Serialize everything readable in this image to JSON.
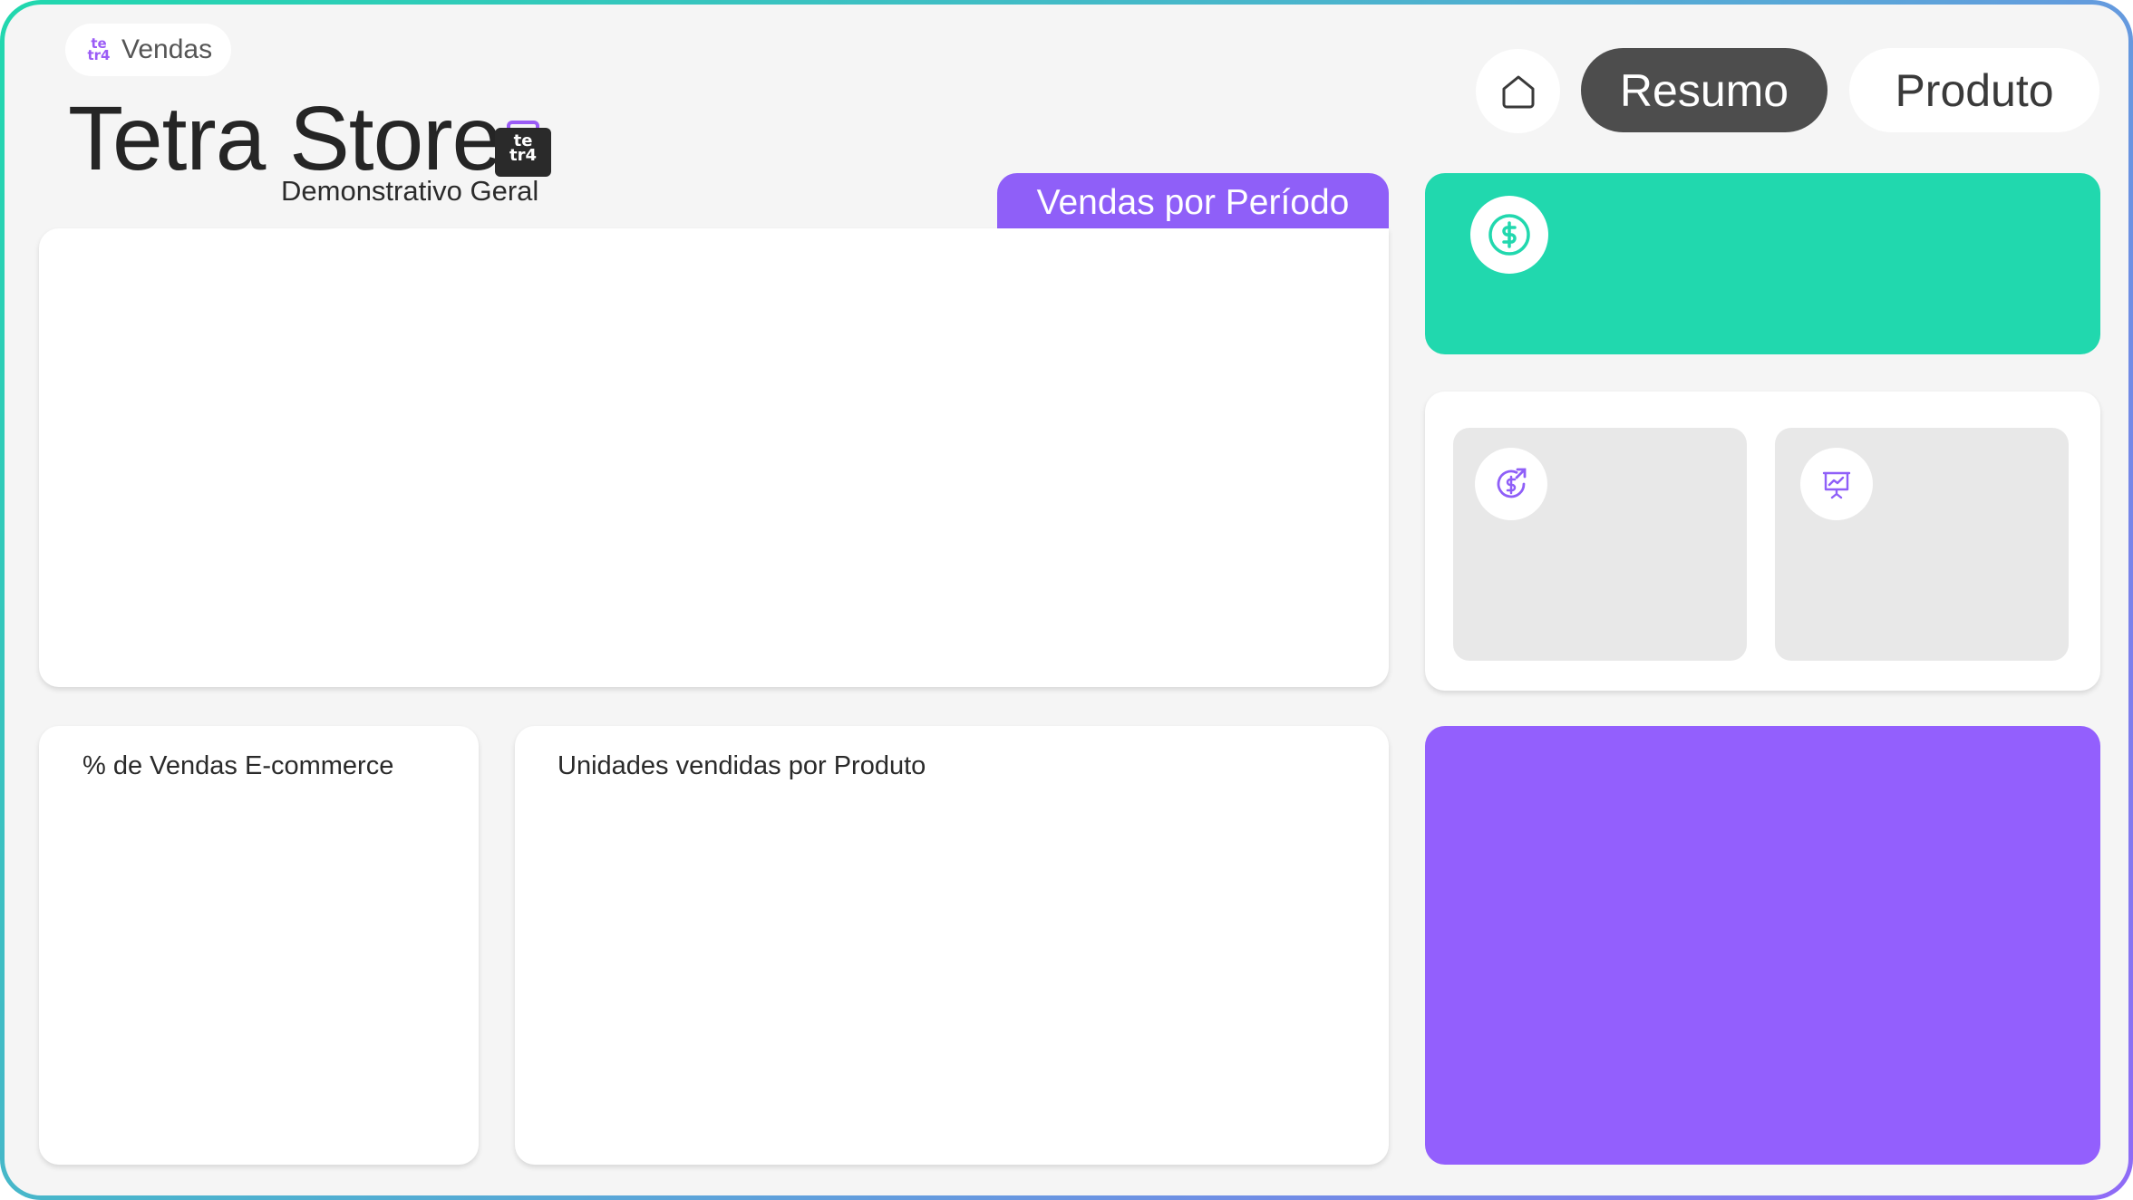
{
  "header": {
    "brand_logo_top": "te",
    "brand_logo_bottom": "tr4",
    "brand_label": "Vendas",
    "title": "Tetra Store",
    "subtitle": "Demonstrativo Geral",
    "bag_logo_top": "te",
    "bag_logo_bottom": "tr4"
  },
  "nav": {
    "home_icon": "home-icon",
    "resumo_label": "Resumo",
    "produto_label": "Produto",
    "active": "Resumo"
  },
  "cards": {
    "period_tab_label": "Vendas por Período",
    "ecommerce_title": "% de Vendas E-commerce",
    "units_title": "Unidades vendidas por Produto"
  },
  "icons": {
    "revenue": "dollar-circle-icon",
    "growth": "dollar-growth-icon",
    "presentation": "presentation-chart-icon"
  },
  "colors": {
    "accent_green": "#21d8ae",
    "accent_purple": "#935ffd",
    "tab_purple": "#8f5ff8",
    "active_nav": "#4d4d4d",
    "background": "#f5f5f5"
  }
}
